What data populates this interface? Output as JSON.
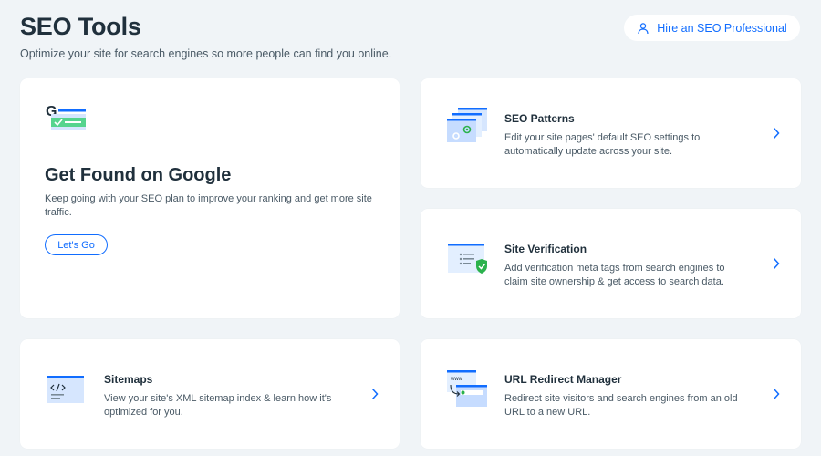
{
  "header": {
    "title": "SEO Tools",
    "subtitle": "Optimize your site for search engines so more people can find you online.",
    "hire_label": "Hire an SEO Professional"
  },
  "main_card": {
    "title": "Get Found on Google",
    "description": "Keep going with your SEO plan to improve your ranking and get more site traffic.",
    "button_label": "Let's Go"
  },
  "tools": {
    "patterns": {
      "title": "SEO Patterns",
      "description": "Edit your site pages' default SEO settings to automatically update across your site."
    },
    "verification": {
      "title": "Site Verification",
      "description": "Add verification meta tags from search engines to claim site ownership & get access to search data."
    },
    "sitemaps": {
      "title": "Sitemaps",
      "description": "View your site's XML sitemap index & learn how it's optimized for you."
    },
    "redirect": {
      "title": "URL Redirect Manager",
      "description": "Redirect site visitors and search engines from an old URL to a new URL."
    }
  },
  "icons": {
    "hire": "person-icon",
    "google": "google-search-icon",
    "patterns": "seo-patterns-icon",
    "verification": "site-verification-icon",
    "sitemaps": "sitemap-icon",
    "redirect": "url-redirect-icon",
    "chevron": "chevron-right-icon"
  },
  "colors": {
    "accent": "#116dff",
    "background": "#f0f4f7",
    "card": "#ffffff",
    "success": "#2bb24c",
    "text": "#20303c"
  }
}
